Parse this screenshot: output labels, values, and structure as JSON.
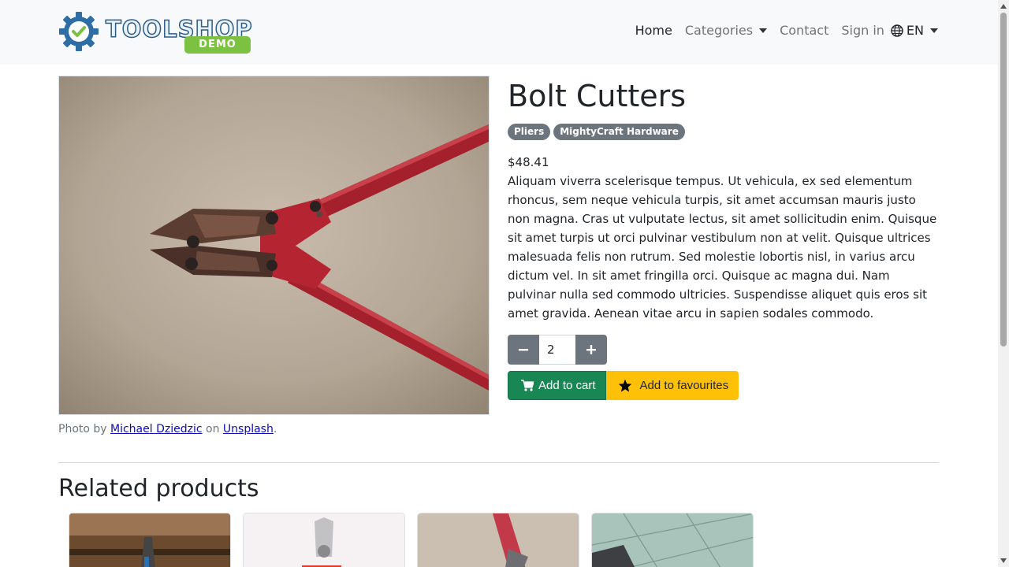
{
  "brand": {
    "name_part1": "TOOL",
    "name_part2": "SHOP",
    "badge": "DEMO"
  },
  "nav": {
    "home": "Home",
    "categories": "Categories",
    "contact": "Contact",
    "signin": "Sign in",
    "language": "EN"
  },
  "product": {
    "title": "Bolt Cutters",
    "category_badge": "Pliers",
    "brand_badge": "MightyCraft Hardware",
    "price": "$48.41",
    "description": "Aliquam viverra scelerisque tempus. Ut vehicula, ex sed elementum rhoncus, sem neque vehicula turpis, sit amet accumsan mauris justo non magna. Cras ut vulputate lectus, sit amet sollicitudin enim. Quisque sit amet turpis ut orci pulvinar vestibulum non at velit. Quisque ultrices malesuada felis non rutrum. Sed molestie lobortis nisl, in varius arcu dictum vel. In sit amet fringilla orci. Quisque ac magna dui. Nam pulvinar nulla sed commodo ultricies. Suspendisse aliquet quis eros sit amet gravida. Aenean vitae arcu in sapien sodales commodo.",
    "quantity": "2",
    "add_to_cart": "Add to cart",
    "add_to_favourites": "Add to favourites"
  },
  "photo_credit": {
    "prefix": "Photo by",
    "author": "Michael Dziedzic",
    "middle": "on",
    "source": "Unsplash",
    "suffix": "."
  },
  "related": {
    "title": "Related products"
  },
  "icons": {
    "logo": "gear-check-icon",
    "globe": "globe-icon",
    "cart": "cart-icon",
    "star": "star-icon",
    "minus": "minus-icon",
    "plus": "plus-icon"
  },
  "colors": {
    "cart_button": "#198754",
    "fav_button": "#ffc107",
    "badge": "#6c757d",
    "qty_button": "#6c757d",
    "navbar_bg": "#f8f9fa"
  }
}
